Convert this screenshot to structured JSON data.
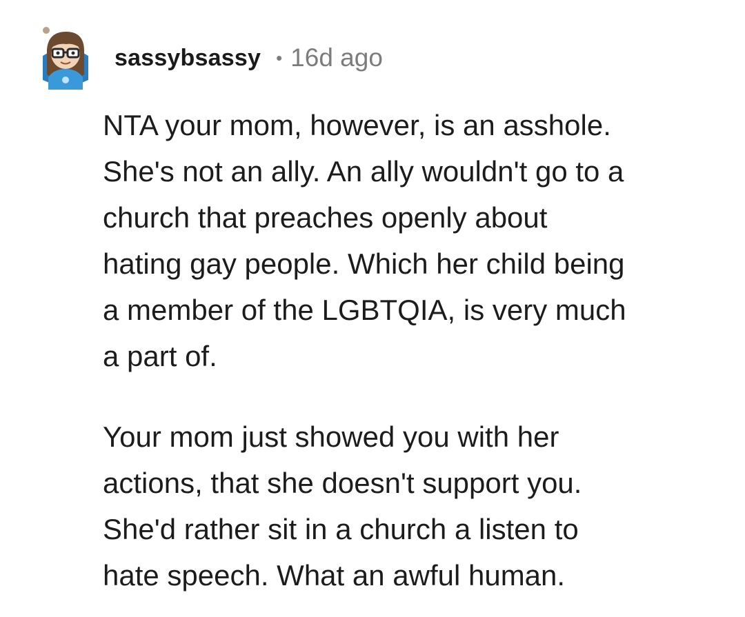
{
  "comment": {
    "author": "sassybsassy",
    "separator": "•",
    "age": "16d ago",
    "paragraphs": [
      "NTA your mom, however, is an asshole.\nShe's not an ally. An ally wouldn't go to a\nchurch that preaches openly about\nhating gay people. Which her child being\na member of the LGBTQIA, is very much\na part of.",
      "Your mom just showed you with her\nactions, that she doesn't support you.\nShe'd rather sit in a church a listen to\nhate speech. What an awful human."
    ],
    "avatar": {
      "icon": "user-avatar-icon",
      "shirt_color": "#3a9ad9",
      "outline_color": "#2b7bbf"
    }
  }
}
